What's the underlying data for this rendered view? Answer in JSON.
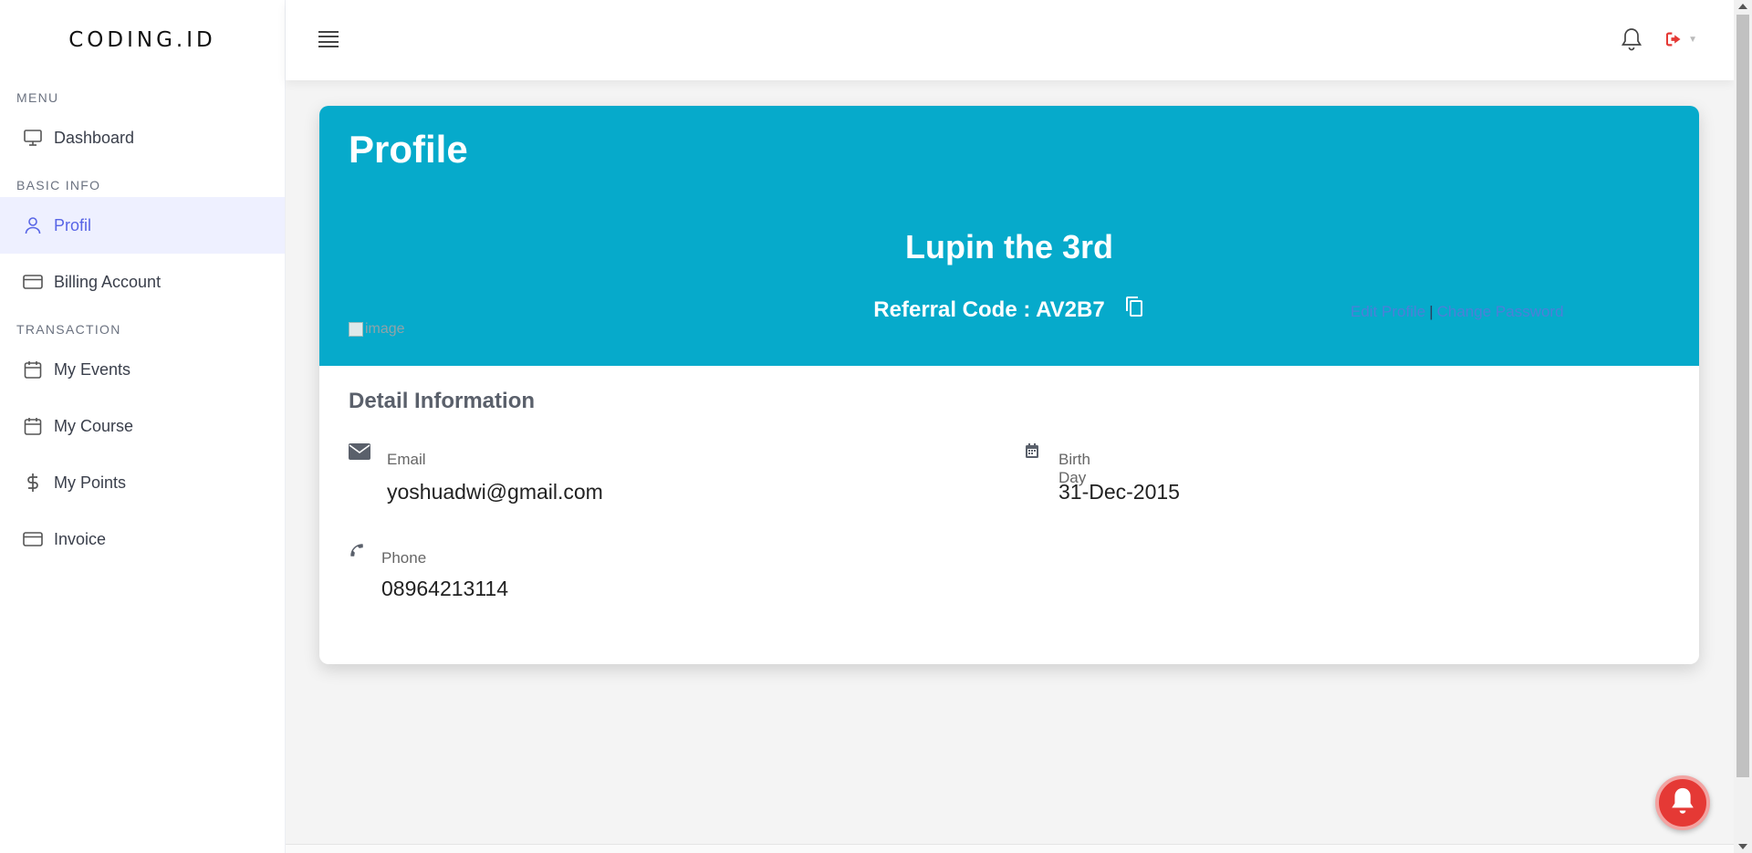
{
  "brand": "CODING.ID",
  "sidebar": {
    "sections": [
      {
        "heading": "MENU",
        "items": [
          {
            "label": "Dashboard",
            "icon": "monitor-icon"
          }
        ]
      },
      {
        "heading": "BASIC INFO",
        "items": [
          {
            "label": "Profil",
            "icon": "user-icon",
            "active": true
          },
          {
            "label": "Billing Account",
            "icon": "credit-card-icon"
          }
        ]
      },
      {
        "heading": "TRANSACTION",
        "items": [
          {
            "label": "My Events",
            "icon": "calendar-icon"
          },
          {
            "label": "My Course",
            "icon": "calendar-icon"
          },
          {
            "label": "My Points",
            "icon": "dollar-icon"
          },
          {
            "label": "Invoice",
            "icon": "credit-card-icon"
          }
        ]
      }
    ]
  },
  "topbar": {
    "menu_icon": "hamburger-icon",
    "notification_icon": "bell-icon",
    "logout_icon": "sign-out-icon"
  },
  "profile": {
    "title": "Profile",
    "name": "Lupin the 3rd",
    "referral_label": "Referral Code : AV2B7",
    "image_alt": "image",
    "edit_profile": "Edit Profile",
    "separator": "|",
    "change_password": "Change Password"
  },
  "detail": {
    "title": "Detail Information",
    "email": {
      "label": "Email",
      "value": "yoshuadwi@gmail.com"
    },
    "birthday": {
      "label": "Birth Day",
      "value": "31-Dec-2015"
    },
    "phone": {
      "label": "Phone",
      "value": "08964213114"
    }
  },
  "colors": {
    "header_bg": "#06aacb",
    "active_bg": "#eef0ff",
    "active_text": "#5865e6",
    "alert_red": "#e53935"
  }
}
